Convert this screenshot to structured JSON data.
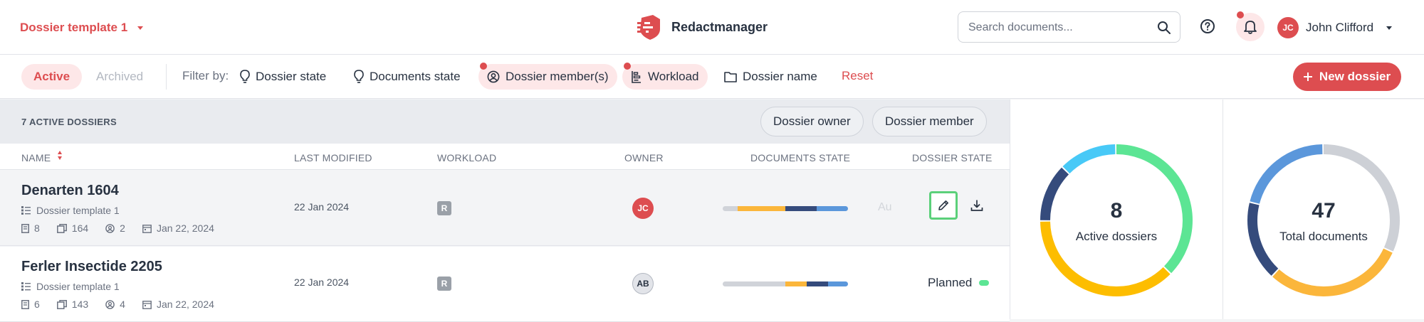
{
  "header": {
    "dossier_template": "Dossier template 1",
    "brand": "Redactmanager",
    "search_placeholder": "Search documents...",
    "user_initials": "JC",
    "user_name": "John Clifford"
  },
  "filters": {
    "tab_active": "Active",
    "tab_archived": "Archived",
    "filter_by": "Filter by:",
    "dossier_state": "Dossier state",
    "documents_state": "Documents state",
    "dossier_members": "Dossier member(s)",
    "workload": "Workload",
    "dossier_name": "Dossier name",
    "reset": "Reset",
    "new_dossier": "New dossier"
  },
  "table": {
    "count_label": "7 ACTIVE DOSSIERS",
    "group_owner": "Dossier owner",
    "group_member": "Dossier member",
    "columns": {
      "name": "NAME",
      "last_modified": "LAST MODIFIED",
      "workload": "WORKLOAD",
      "owner": "OWNER",
      "documents_state": "DOCUMENTS STATE",
      "dossier_state": "DOSSIER STATE"
    },
    "rows": [
      {
        "name": "Denarten 1604",
        "template": "Dossier template 1",
        "docs": "8",
        "pages": "164",
        "members": "2",
        "date": "Jan 22, 2024",
        "last_modified": "22 Jan 2024",
        "workload": "R",
        "owner": "JC",
        "state_faded": "Au",
        "doc_state_segments": [
          {
            "color": "#d0d3d9",
            "share": 0.12
          },
          {
            "color": "#fbb63b",
            "share": 0.38
          },
          {
            "color": "#354b7c",
            "share": 0.25
          },
          {
            "color": "#5b97db",
            "share": 0.25
          }
        ]
      },
      {
        "name": "Ferler Insectide 2205",
        "template": "Dossier template 1",
        "docs": "6",
        "pages": "143",
        "members": "4",
        "date": "Jan 22, 2024",
        "last_modified": "22 Jan 2024",
        "workload": "R",
        "owner": "AB",
        "dossier_state": "Planned",
        "doc_state_segments": [
          {
            "color": "#d0d3d9",
            "share": 0.5
          },
          {
            "color": "#fbb63b",
            "share": 0.17
          },
          {
            "color": "#354b7c",
            "share": 0.17
          },
          {
            "color": "#5b97db",
            "share": 0.16
          }
        ]
      }
    ]
  },
  "stats": {
    "active": {
      "value": "8",
      "label": "Active dossiers",
      "segments": [
        {
          "color": "#5ce594",
          "share": 0.375
        },
        {
          "color": "#fdbd00",
          "share": 0.375
        },
        {
          "color": "#354b7c",
          "share": 0.125
        },
        {
          "color": "#48c9f7",
          "share": 0.125
        }
      ]
    },
    "total": {
      "value": "47",
      "label": "Total documents",
      "segments": [
        {
          "color": "#cdd0d6",
          "share": 0.32
        },
        {
          "color": "#fbb63b",
          "share": 0.3
        },
        {
          "color": "#354b7c",
          "share": 0.17
        },
        {
          "color": "#5b97db",
          "share": 0.21
        }
      ]
    }
  }
}
